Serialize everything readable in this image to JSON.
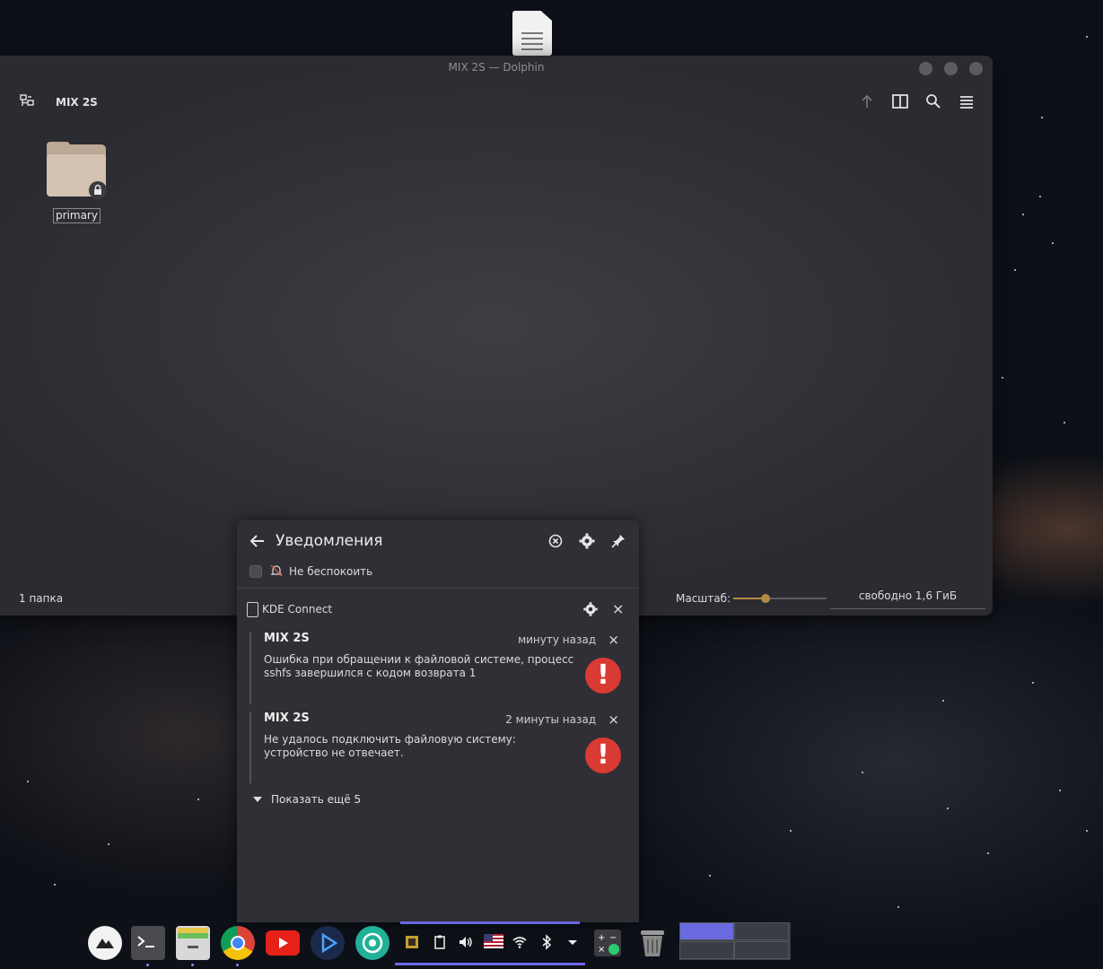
{
  "desktop": {
    "file_icon": "document-icon"
  },
  "window": {
    "title": "MIX 2S — Dolphin",
    "breadcrumb": "MIX 2S",
    "folder_name": "primary",
    "status_left": "1 папка",
    "zoom_label": "Масштаб:",
    "zoom_level": 0.35,
    "free_space": "свободно 1,6 ГиБ",
    "icons": [
      "places-panel-icon",
      "up-arrow-icon",
      "split-view-icon",
      "search-icon",
      "hamburger-menu-icon"
    ],
    "colors": {
      "accent": "#b48a44",
      "folder": "#d4c3b3"
    }
  },
  "notifications": {
    "title": "Уведомления",
    "dnd_label": "Не беспокоить",
    "app_name": "KDE Connect",
    "items": [
      {
        "title": "MIX 2S",
        "time": "минуту назад",
        "body": "Ошибка при обращении к файловой системе, процесс sshfs завершился с кодом возврата 1"
      },
      {
        "title": "MIX 2S",
        "time": "2 минуты назад",
        "body": "Не удалось подключить файловую систему: устройство не отвечает."
      }
    ],
    "show_more": "Показать ещё 5",
    "close_glyph": "×",
    "error_glyph": "!",
    "colors": {
      "error": "#d93a33"
    }
  },
  "dock": {
    "apps": [
      "launcher-icon",
      "terminal-icon",
      "file-manager-icon",
      "chrome-icon",
      "youtube-icon",
      "media-player-icon",
      "aperture-icon",
      "calculator-icon",
      "trash-icon"
    ],
    "tray": [
      "cpu-monitor-icon",
      "clipboard-icon",
      "volume-icon",
      "us-flag-icon",
      "wifi-icon",
      "bluetooth-icon",
      "tray-expand-icon"
    ],
    "colors": {
      "accent": "#6b67e6"
    }
  }
}
